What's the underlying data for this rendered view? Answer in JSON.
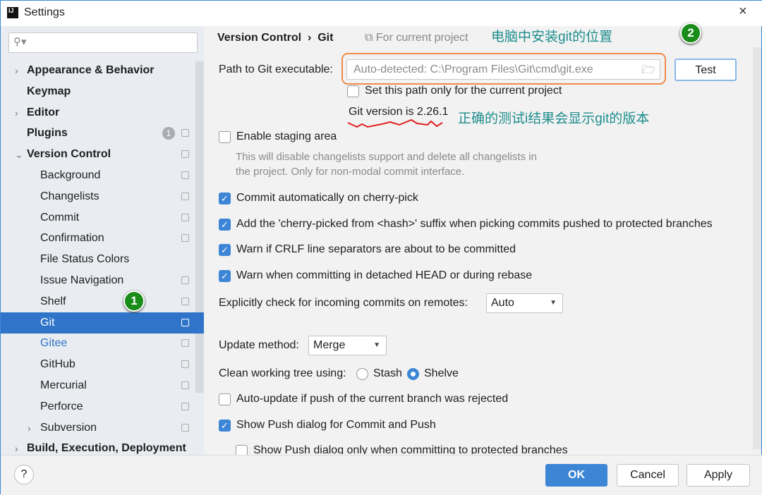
{
  "window": {
    "title": "Settings",
    "app_icon": "IJ"
  },
  "search": {
    "placeholder": ""
  },
  "sidebar": {
    "items": [
      {
        "label": "Appearance & Behavior",
        "bold": true,
        "chevron": true,
        "indent": 0
      },
      {
        "label": "Keymap",
        "bold": true,
        "indent": 0
      },
      {
        "label": "Editor",
        "bold": true,
        "chevron": true,
        "indent": 0
      },
      {
        "label": "Plugins",
        "bold": true,
        "indent": 0,
        "badge": "1",
        "copy": true
      },
      {
        "label": "Version Control",
        "bold": true,
        "chevron": true,
        "expanded": true,
        "indent": 0,
        "copy": true
      },
      {
        "label": "Background",
        "indent": 1,
        "copy": true
      },
      {
        "label": "Changelists",
        "indent": 1,
        "copy": true
      },
      {
        "label": "Commit",
        "indent": 1,
        "copy": true
      },
      {
        "label": "Confirmation",
        "indent": 1,
        "copy": true
      },
      {
        "label": "File Status Colors",
        "indent": 1
      },
      {
        "label": "Issue Navigation",
        "indent": 1,
        "copy": true
      },
      {
        "label": "Shelf",
        "indent": 1,
        "copy": true
      },
      {
        "label": "Git",
        "indent": 1,
        "copy": true,
        "selected": true
      },
      {
        "label": "Gitee",
        "indent": 1,
        "copy": true,
        "link": true
      },
      {
        "label": "GitHub",
        "indent": 1,
        "copy": true
      },
      {
        "label": "Mercurial",
        "indent": 1,
        "copy": true
      },
      {
        "label": "Perforce",
        "indent": 1,
        "copy": true
      },
      {
        "label": "Subversion",
        "indent": 1,
        "copy": true,
        "chevron": true
      },
      {
        "label": "Build, Execution, Deployment",
        "bold": true,
        "chevron": true,
        "indent": 0
      }
    ]
  },
  "annotations": {
    "marker1": "1",
    "marker2": "2",
    "note_path": "电脑中安装git的位置",
    "note_version": "正确的测试i结果会显示git的版本"
  },
  "main": {
    "breadcrumb": [
      "Version Control",
      "Git"
    ],
    "for_project": "For current project",
    "path_label": "Path to Git executable:",
    "path_placeholder": "Auto-detected: C:\\Program Files\\Git\\cmd\\git.exe",
    "test_button": "Test",
    "set_path_only": "Set this path only for the current project",
    "git_version": "Git version is 2.26.1",
    "staging": "Enable staging area",
    "staging_desc1": "This will disable changelists support and delete all changelists in",
    "staging_desc2": "the project. Only for non-modal commit interface.",
    "options": [
      {
        "label": "Commit automatically on cherry-pick",
        "checked": true
      },
      {
        "label": "Add the 'cherry-picked from <hash>' suffix when picking commits pushed to protected branches",
        "checked": true
      },
      {
        "label": "Warn if CRLF line separators are about to be committed",
        "checked": true
      },
      {
        "label": "Warn when committing in detached HEAD or during rebase",
        "checked": true
      }
    ],
    "incoming_label": "Explicitly check for incoming commits on remotes:",
    "incoming_value": "Auto",
    "update_label": "Update method:",
    "update_value": "Merge",
    "clean_label": "Clean working tree using:",
    "clean_options": [
      "Stash",
      "Shelve"
    ],
    "clean_selected": "Shelve",
    "auto_update": "Auto-update if push of the current branch was rejected",
    "show_push": "Show Push dialog for Commit and Push",
    "show_push_protected": "Show Push dialog only when committing to protected branches"
  },
  "footer": {
    "ok": "OK",
    "cancel": "Cancel",
    "apply": "Apply",
    "help": "?"
  },
  "colors": {
    "accent": "#3d86d6",
    "selection": "#2f74c8",
    "annotation_text": "#1f8d8d",
    "highlight_box": "#f08a4b",
    "underline": "#e02020",
    "marker": "#1a8c1a"
  }
}
